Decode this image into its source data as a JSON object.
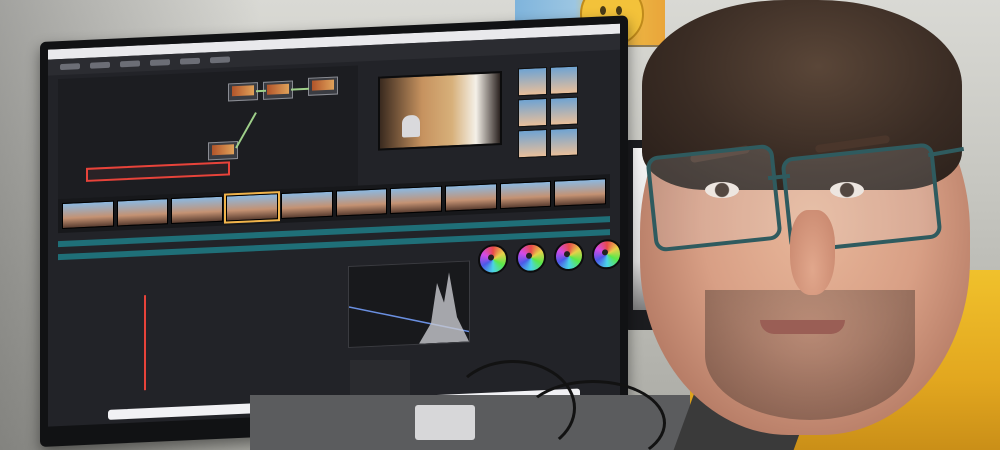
{
  "scene": {
    "description_keys": [
      "monitor",
      "person",
      "desk"
    ],
    "colors": {
      "accent_red": "#e8433a",
      "jacket_yellow": "#f0c12c",
      "glasses_teal": "#2f5b5f"
    },
    "icons": {
      "smiley_icon": "smiley-face",
      "wheel_icon": "color-wheel"
    }
  }
}
